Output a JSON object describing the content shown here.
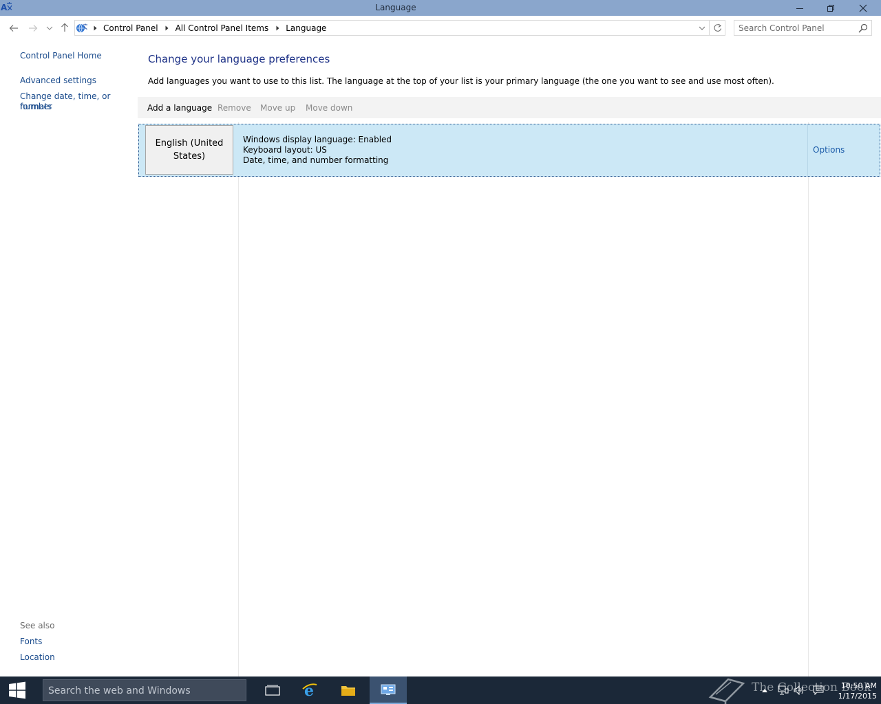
{
  "window": {
    "title": "Language"
  },
  "address_bar": {
    "breadcrumbs": [
      "Control Panel",
      "All Control Panel Items",
      "Language"
    ],
    "search_placeholder": "Search Control Panel"
  },
  "left_pane": {
    "home_link": "Control Panel Home",
    "links": [
      "Advanced settings",
      "Change date, time, or number",
      "formats"
    ],
    "see_also_label": "See also",
    "see_also_links": [
      "Fonts",
      "Location"
    ]
  },
  "main": {
    "heading": "Change your language preferences",
    "description": "Add languages you want to use to this list. The language at the top of your list is your primary language (the one you want to see and use most often).",
    "toolbar": {
      "add": "Add a language",
      "remove": "Remove",
      "move_up": "Move up",
      "move_down": "Move down"
    },
    "languages": [
      {
        "tile_line1": "English (United",
        "tile_line2": "States)",
        "details": [
          "Windows display language: Enabled",
          "Keyboard layout: US",
          "Date, time, and number formatting"
        ],
        "options_label": "Options"
      }
    ]
  },
  "taskbar": {
    "search_placeholder": "Search the web and Windows",
    "watermark": "The Collection Book",
    "time": "10:50 AM",
    "date": "1/17/2015"
  },
  "colors": {
    "titlebar": "#8aa6cc",
    "link": "#1a4b8c",
    "heading": "#1e3287",
    "selected_row": "#cce8f6",
    "taskbar": "#1b2838"
  },
  "icons": {
    "app": "language-icon",
    "back": "arrow-left-icon",
    "forward": "arrow-right-icon",
    "recent": "chevron-down-icon",
    "up": "arrow-up-icon",
    "refresh": "refresh-icon",
    "search": "search-icon",
    "start": "windows-logo-icon"
  }
}
